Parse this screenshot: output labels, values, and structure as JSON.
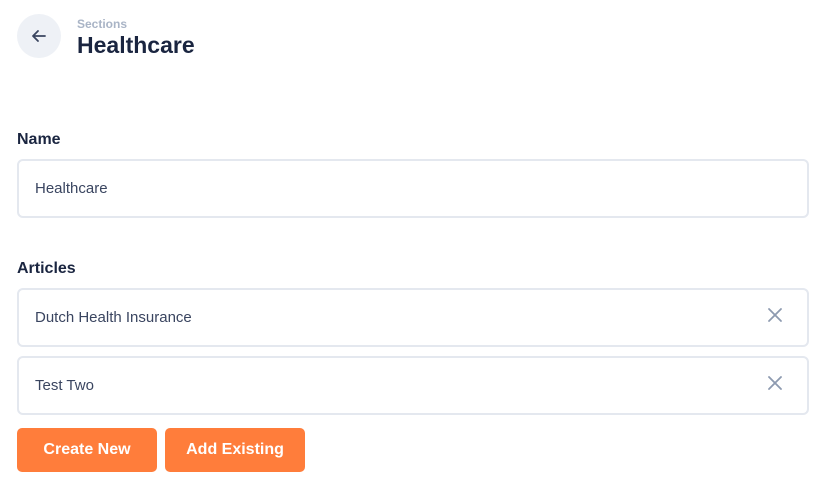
{
  "header": {
    "breadcrumb": "Sections",
    "title": "Healthcare",
    "back_icon": "arrow-left-icon"
  },
  "form": {
    "name_label": "Name",
    "name_value": "Healthcare",
    "articles_label": "Articles",
    "articles": [
      {
        "title": "Dutch Health Insurance",
        "remove_icon": "close-icon"
      },
      {
        "title": "Test Two",
        "remove_icon": "close-icon"
      }
    ]
  },
  "actions": {
    "create_new_label": "Create New",
    "add_existing_label": "Add Existing"
  },
  "colors": {
    "accent": "#ff7d3b",
    "title": "#1a2540",
    "muted": "#a9b4c6",
    "border": "#e4e8ef",
    "back_bg": "#eef1f6"
  }
}
